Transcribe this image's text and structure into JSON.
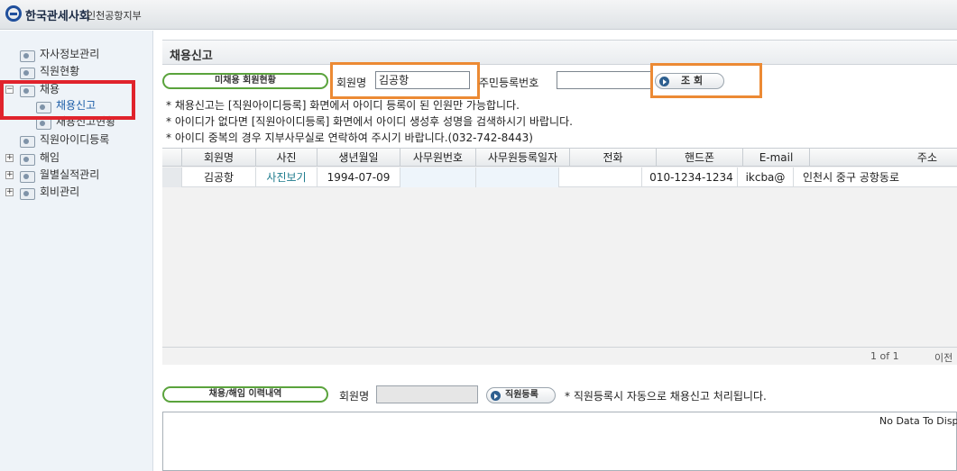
{
  "header": {
    "org_name": "한국관세사회",
    "branch_name": "인천공항지부"
  },
  "sidebar": {
    "items": [
      {
        "label": "자사정보관리"
      },
      {
        "label": "직원현황"
      },
      {
        "label": "채용",
        "expander": "⊟"
      },
      {
        "label": "채용신고"
      },
      {
        "label": "채용신고현황"
      },
      {
        "label": "직원아이디등록"
      },
      {
        "label": "해임",
        "expander": "⊞"
      },
      {
        "label": "월별실적관리",
        "expander": "⊞"
      },
      {
        "label": "회비관리",
        "expander": "⊞"
      }
    ]
  },
  "panel": {
    "title": "채용신고",
    "unemployed_btn": "미채용 회원현황",
    "member_name_label": "회원명",
    "member_name_value": "김공항",
    "rrn_label": "주민등록번호",
    "rrn_value": "",
    "search_btn": "조 회"
  },
  "notices": [
    "* 채용신고는 [직원아이디등록] 화면에서 아이디 등록이 된 인원만 가능합니다.",
    "* 아이디가 없다면 [직원아이디등록] 화면에서 아이디 생성후 성명을 검색하시기 바랍니다.",
    "* 아이디 중복의 경우 지부사무실로 연락하여 주시기 바랍니다.(032-742-8443)"
  ],
  "grid": {
    "columns": [
      "회원명",
      "사진",
      "생년월일",
      "사무원번호",
      "사무원등록일자",
      "전화",
      "핸드폰",
      "E-mail",
      "주소"
    ],
    "rows": [
      [
        "김공항",
        "사진보기",
        "1994-07-09",
        "",
        "",
        "",
        "010-1234-1234",
        "ikcba@",
        "인천시 중구 공항동로"
      ]
    ],
    "paging": "1 of 1",
    "prev": "이전"
  },
  "history": {
    "btn": "채용/해임 이력내역",
    "member_name_label": "회원명",
    "member_name_value": "",
    "register_btn": "직원등록",
    "notice": "* 직원등록시 자동으로 채용신고 처리됩니다.",
    "no_data": "No Data To Display"
  },
  "colors": {
    "highlight_red": "#e0232c",
    "highlight_orange": "#ec8a34",
    "pill_border": "#5aa33c"
  }
}
